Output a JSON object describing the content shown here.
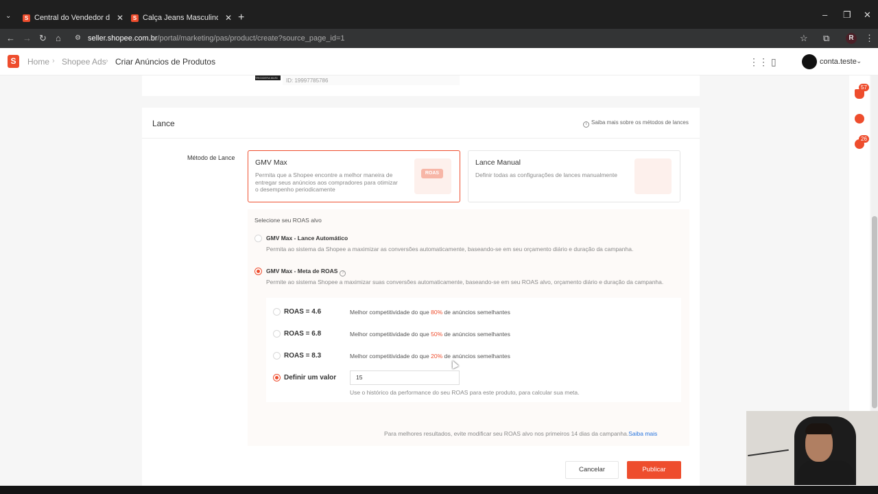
{
  "browser": {
    "tabs": [
      {
        "title": "Central do Vendedor da Shopee",
        "close": "✕"
      },
      {
        "title": "Calça Jeans Masculino Skinny M",
        "close": "✕"
      }
    ],
    "new_tab": "+",
    "url_host": "seller.shopee.com.br",
    "url_path": "/portal/marketing/pas/product/create?source_page_id=1",
    "profile_initial": "R"
  },
  "header": {
    "logo": "S",
    "breadcrumb": [
      "Home",
      "Shopee Ads",
      "Criar Anúncios de Produtos"
    ],
    "user": "conta.teste"
  },
  "rail": {
    "badge1": "57",
    "badge2": "26"
  },
  "product": {
    "id": "ID: 19997785786",
    "thumb_text": "TRIGIDERA MUSI"
  },
  "lance": {
    "title": "Lance",
    "help": "Saiba mais sobre os métodos de lances",
    "method_label": "Método de Lance",
    "options": [
      {
        "title": "GMV Max",
        "desc": "Permita que a Shopee encontre a melhor maneira de entregar seus anúncios aos compradores para otimizar o desempenho periodicamente",
        "selected": true,
        "badge": "ROAS"
      },
      {
        "title": "Lance Manual",
        "desc": "Definir todas as configurações de lances manualmente",
        "selected": false
      }
    ]
  },
  "roas": {
    "header": "Selecione seu ROAS alvo",
    "auto": {
      "title": "GMV Max - Lance Automático",
      "desc": "Permita ao sistema da Shopee a maximizar as conversões automaticamente, baseando-se em seu orçamento diário e duração da campanha."
    },
    "meta": {
      "title": "GMV Max - Meta de ROAS",
      "desc": "Permite ao sistema Shopee a maximizar suas conversões automaticamente, baseando-se em seu ROAS alvo, orçamento diário e duração da campanha."
    },
    "levels": [
      {
        "label": "ROAS = 4.6",
        "pre": "Melhor competitividade do que ",
        "pct": "80%",
        "post": " de anúncios semelhantes"
      },
      {
        "label": "ROAS = 6.8",
        "pre": "Melhor competitividade do que ",
        "pct": "50%",
        "post": " de anúncios semelhantes"
      },
      {
        "label": "ROAS = 8.3",
        "pre": "Melhor competitividade do que ",
        "pct": "20%",
        "post": " de anúncios semelhantes"
      }
    ],
    "custom_label": "Definir um valor",
    "custom_value": "15",
    "hint": "Use o histórico da performance do seu ROAS para este produto, para calcular sua meta.",
    "footer": "Para melhores resultados, evite modificar seu ROAS alvo nos primeiros 14 dias da campanha.",
    "footer_link": "Saiba mais"
  },
  "actions": {
    "cancel": "Cancelar",
    "publish": "Publicar"
  },
  "colors": {
    "accent": "#ee4d2d",
    "link": "#2673dd"
  }
}
